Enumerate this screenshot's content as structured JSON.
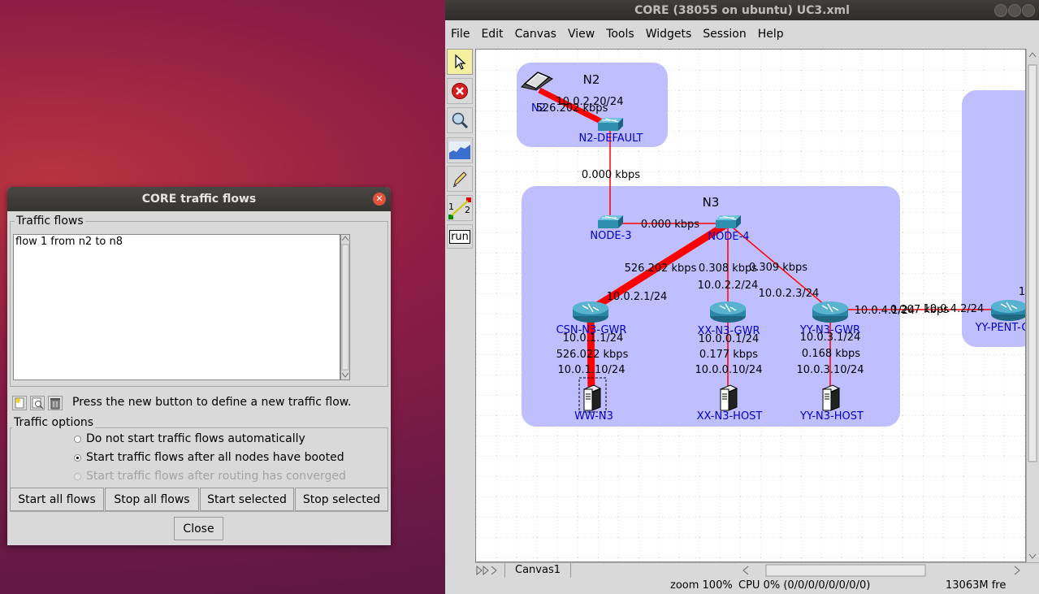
{
  "main_window": {
    "title": "CORE (38055 on ubuntu) UC3.xml",
    "menu": [
      "File",
      "Edit",
      "Canvas",
      "View",
      "Tools",
      "Widgets",
      "Session",
      "Help"
    ],
    "toolbar": {
      "tools": [
        "select-tool",
        "stop-tool",
        "zoom-tool",
        "throughput-plot-tool",
        "marker-tool",
        "two-node-tool",
        "run-tool"
      ],
      "run_label": "run",
      "two_node_labels": [
        "1",
        "2"
      ]
    },
    "canvas": {
      "groups": [
        {
          "id": "N2",
          "label": "N2"
        },
        {
          "id": "N3",
          "label": "N3"
        }
      ],
      "nodes": [
        {
          "id": "n2",
          "label": "N2",
          "kind": "laptop"
        },
        {
          "id": "n2-default",
          "label": "N2-DEFAULT",
          "kind": "switch"
        },
        {
          "id": "node-3",
          "label": "NODE-3",
          "kind": "switch"
        },
        {
          "id": "node-4",
          "label": "NODE-4",
          "kind": "switch"
        },
        {
          "id": "csn-n3-gwr",
          "label": "CSN-N3-GWR",
          "kind": "router"
        },
        {
          "id": "xx-n3-gwr",
          "label": "XX-N3-GWR",
          "kind": "router"
        },
        {
          "id": "yy-n3-gwr",
          "label": "YY-N3-GWR",
          "kind": "router"
        },
        {
          "id": "yy-pent-g",
          "label": "YY-PENT-G",
          "kind": "router"
        },
        {
          "id": "ww-n3",
          "label": "WW-N3",
          "kind": "server"
        },
        {
          "id": "xx-n3-host",
          "label": "XX-N3-HOST",
          "kind": "server"
        },
        {
          "id": "yy-n3-host",
          "label": "YY-N3-HOST",
          "kind": "server"
        }
      ],
      "link_labels": {
        "n2_ip": "10.0.2.20/24",
        "n2_rate": "526.202 kbps",
        "n2default_node3": "0.000 kbps",
        "node3_node4": "0.000 kbps",
        "node4_csn_rate": "526.202 kbps",
        "node4_xx_rate": "0.308 kbps",
        "node4_yy_rate": "0.309 kbps",
        "csn_ip": "10.0.2.1/24",
        "xx_ip": "10.0.2.2/24",
        "yy_ip": "10.0.2.3/24",
        "yy_pent_ip_left": "10.0.4.1/24",
        "yy_pent_rate": "0.207 kbps",
        "yy_pent_ip_right": "10.0.4.2/24",
        "csn_lan_ip": "10.0.1.1/24",
        "csn_host_rate": "526.022 kbps",
        "ww_ip": "10.0.1.10/24",
        "xx_lan_ip": "10.0.0.1/24",
        "xx_host_rate": "0.177 kbps",
        "xx_host_ip": "10.0.0.10/24",
        "yy_lan_ip": "10.0.3.1/24",
        "yy_host_rate": "0.168 kbps",
        "yy_host_ip": "10.0.3.10/24",
        "edge_fragment": "1"
      }
    },
    "tab_label": "Canvas1",
    "status": {
      "zoom": "zoom 100%",
      "cpu": "CPU 0% (0/0/0/0/0/0/0/0)",
      "mem": "13063M fre"
    },
    "colors": {
      "link": "#ff0000",
      "group_fill": "#b8b8ff",
      "label_blue": "#0000c8"
    }
  },
  "flows_dialog": {
    "title": "CORE traffic flows",
    "flows_group_label": "Traffic flows",
    "flows": [
      "flow 1 from n2 to n8"
    ],
    "hint": "Press the new button to define a new traffic flow.",
    "options_group_label": "Traffic options",
    "options": [
      {
        "label": "Do not start traffic flows automatically",
        "selected": false,
        "enabled": true
      },
      {
        "label": "Start traffic flows after all nodes have booted",
        "selected": true,
        "enabled": true
      },
      {
        "label": "Start traffic flows after routing has converged",
        "selected": false,
        "enabled": false
      }
    ],
    "buttons": {
      "start_all": "Start all flows",
      "stop_all": "Stop all flows",
      "start_selected": "Start selected",
      "stop_selected": "Stop selected",
      "close": "Close"
    }
  }
}
